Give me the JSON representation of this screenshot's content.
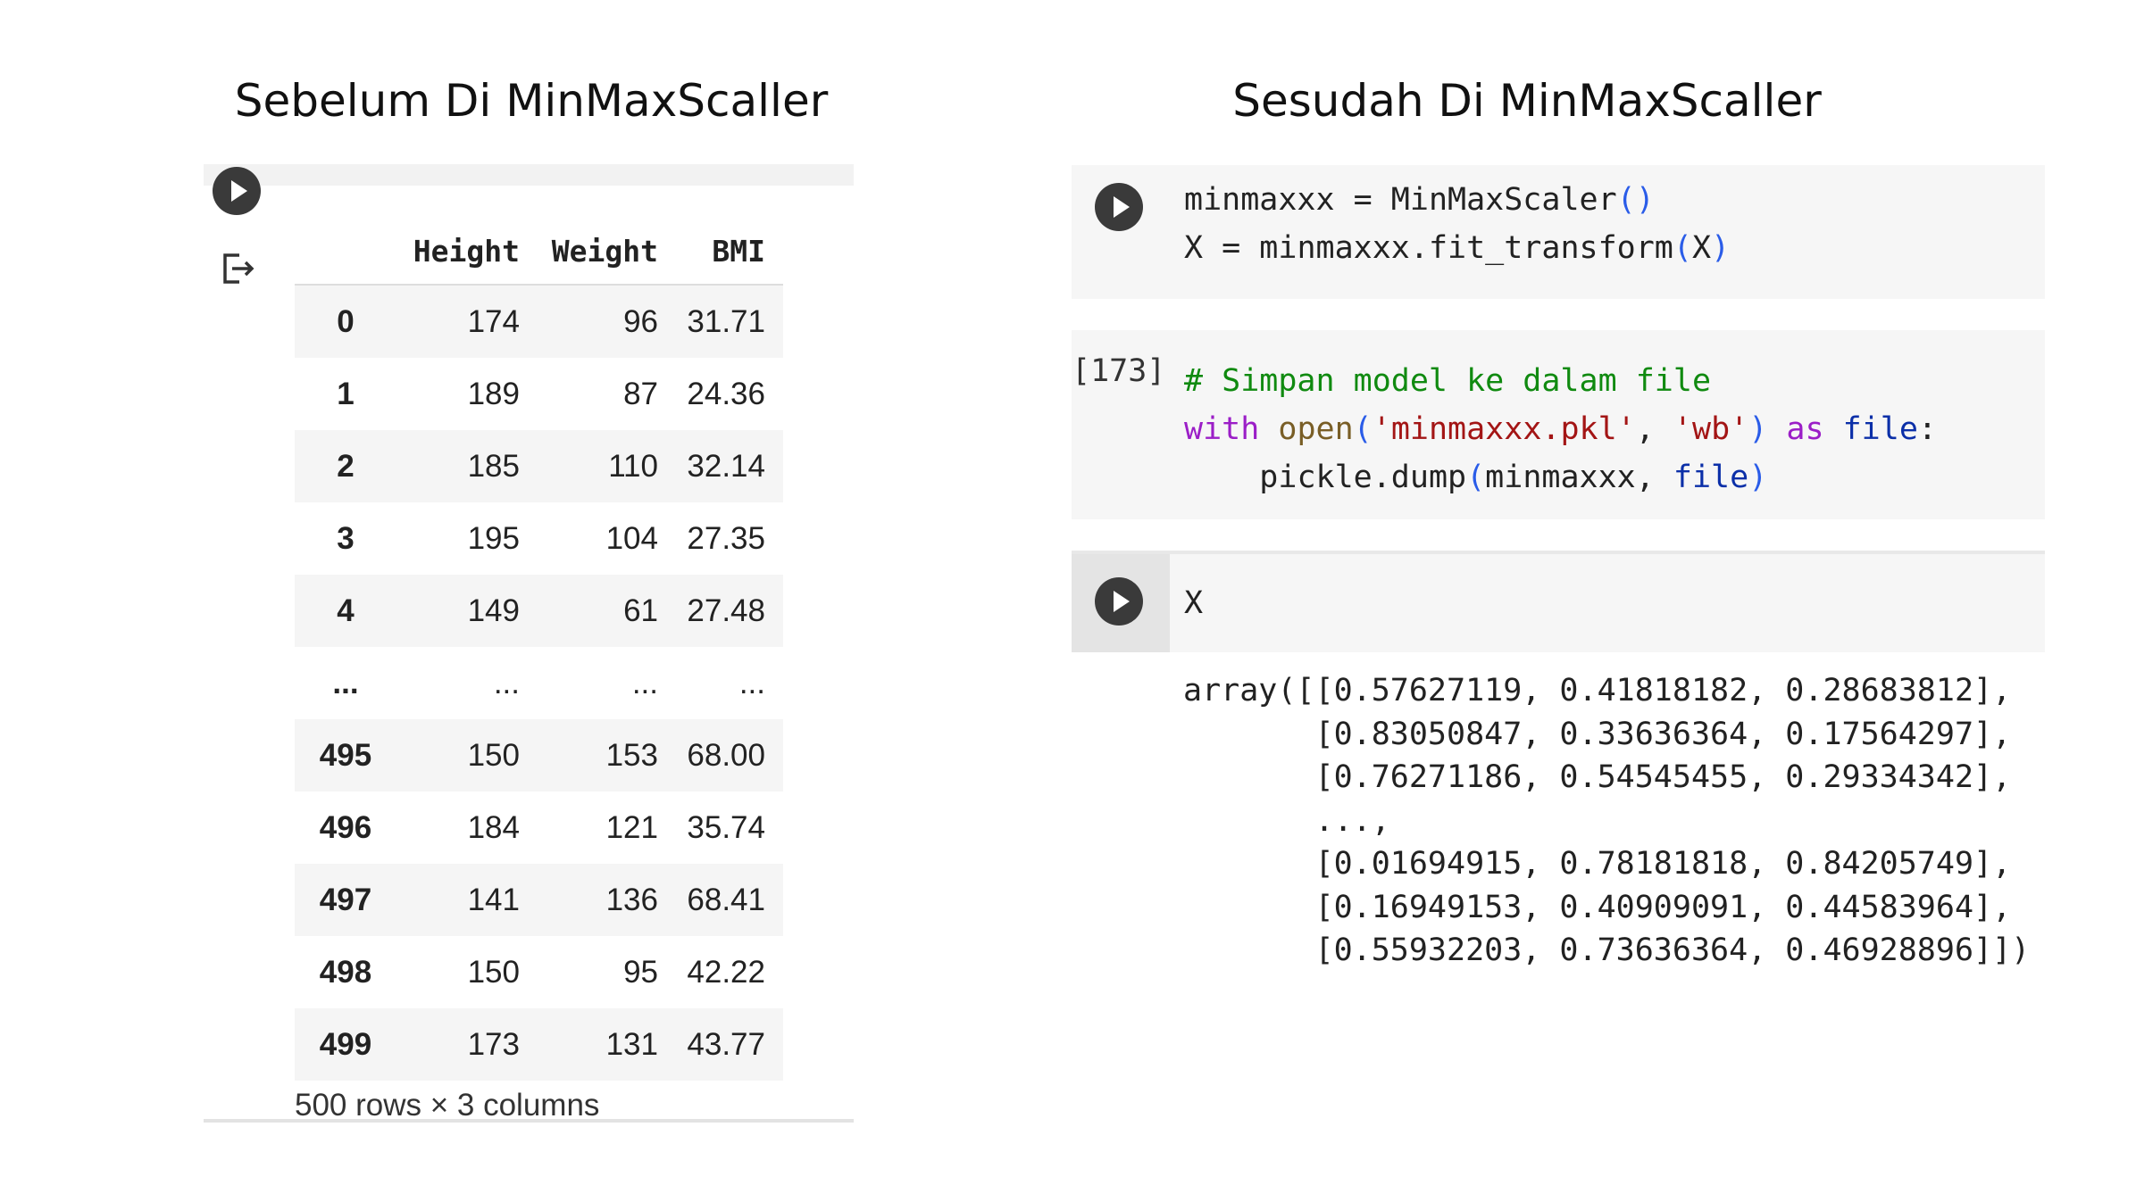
{
  "headings": {
    "left": "Sebelum Di MinMaxScaller",
    "right": "Sesudah Di MinMaxScaller"
  },
  "dataframe": {
    "columns": [
      "Height",
      "Weight",
      "BMI"
    ],
    "rows": [
      {
        "index": "0",
        "values": [
          "174",
          "96",
          "31.71"
        ]
      },
      {
        "index": "1",
        "values": [
          "189",
          "87",
          "24.36"
        ]
      },
      {
        "index": "2",
        "values": [
          "185",
          "110",
          "32.14"
        ]
      },
      {
        "index": "3",
        "values": [
          "195",
          "104",
          "27.35"
        ]
      },
      {
        "index": "4",
        "values": [
          "149",
          "61",
          "27.48"
        ]
      },
      {
        "index": "...",
        "values": [
          "...",
          "...",
          "..."
        ]
      },
      {
        "index": "495",
        "values": [
          "150",
          "153",
          "68.00"
        ]
      },
      {
        "index": "496",
        "values": [
          "184",
          "121",
          "35.74"
        ]
      },
      {
        "index": "497",
        "values": [
          "141",
          "136",
          "68.41"
        ]
      },
      {
        "index": "498",
        "values": [
          "150",
          "95",
          "42.22"
        ]
      },
      {
        "index": "499",
        "values": [
          "173",
          "131",
          "43.77"
        ]
      }
    ],
    "shape_text": "500 rows × 3 columns"
  },
  "cells": {
    "cell1": {
      "line1": {
        "var": "minmaxxx",
        "op": " = ",
        "call": "MinMaxScaler",
        "open": "(",
        "close": ")"
      },
      "line2": {
        "lhs": "X = ",
        "obj": "minmaxxx",
        "method": ".fit_transform",
        "open": "(",
        "arg": "X",
        "close": ")"
      }
    },
    "cell2": {
      "exec_count": "[173]",
      "comment": "# Simpan model ke dalam file",
      "line2": {
        "kw_with": "with",
        "fn_open": "open",
        "lp": "(",
        "str1": "'minmaxxx.pkl'",
        "comma": ", ",
        "str2": "'wb'",
        "rp": ")",
        "kw_as": "as",
        "var_file": "file",
        "colon": ":"
      },
      "line3": {
        "indent": "    ",
        "call": "pickle.dump",
        "lp": "(",
        "arg1": "minmaxxx, ",
        "arg2": "file",
        "rp": ")"
      }
    },
    "cell3": {
      "code": "X"
    }
  },
  "output": {
    "array_lines": [
      "array([[0.57627119, 0.41818182, 0.28683812],",
      "       [0.83050847, 0.33636364, 0.17564297],",
      "       [0.76271186, 0.54545455, 0.29334342],",
      "       ...,",
      "       [0.01694915, 0.78181818, 0.84205749],",
      "       [0.16949153, 0.40909091, 0.44583964],",
      "       [0.55932203, 0.73636364, 0.46928896]])"
    ]
  }
}
